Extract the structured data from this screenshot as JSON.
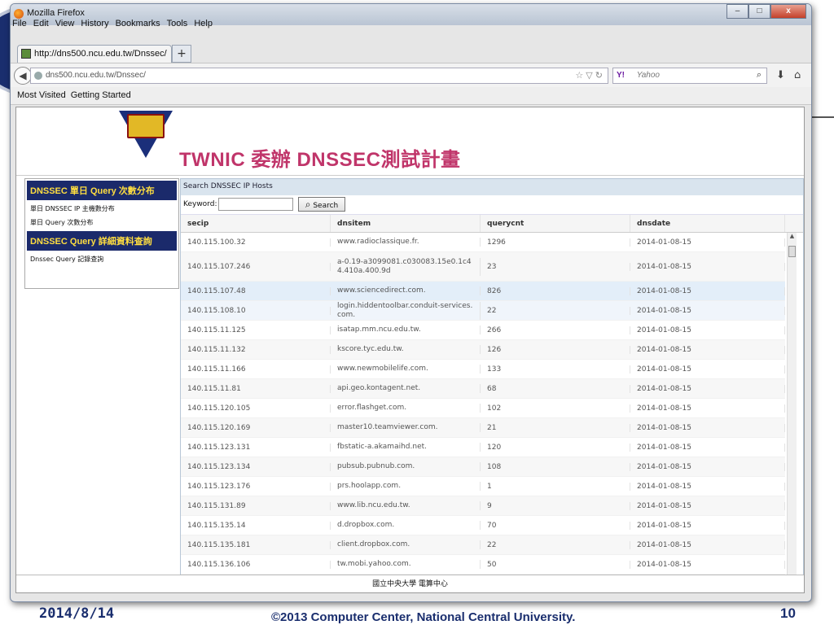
{
  "browser": {
    "window_title": "Mozilla Firefox",
    "menu": [
      "File",
      "Edit",
      "View",
      "History",
      "Bookmarks",
      "Tools",
      "Help"
    ],
    "tab_label": "http://dns500.ncu.edu.tw/Dnssec/",
    "new_tab": "+",
    "url": "dns500.ncu.edu.tw/Dnssec/",
    "search_engine": "Yahoo",
    "bookmarks": [
      "Most Visited",
      "Getting Started"
    ]
  },
  "site": {
    "title": "TWNIC 委辦 DNSSEC測試計畫",
    "sidebar": {
      "section1": "DNSSEC 單日 Query 次數分布",
      "section1_items": [
        "單日 DNSSEC IP 主機數分布",
        "單日 Query 次數分布"
      ],
      "section2": "DNSSEC Query 詳細資料查詢",
      "section2_items": [
        "Dnssec Query 記錄查詢"
      ]
    },
    "panel_title": "Search DNSSEC IP Hosts",
    "keyword_label": "Keyword:",
    "search_button": "Search",
    "columns": [
      "secip",
      "dnsitem",
      "querycnt",
      "dnsdate"
    ],
    "rows": [
      [
        "140.115.100.32",
        "www.radioclassique.fr.",
        "1296",
        "2014-01-08-15"
      ],
      [
        "140.115.107.246",
        "a-0.19-a3099081.c030083.15e0.1c44.410a.400.9d",
        "23",
        "2014-01-08-15"
      ],
      [
        "140.115.107.48",
        "www.sciencedirect.com.",
        "826",
        "2014-01-08-15"
      ],
      [
        "140.115.108.10",
        "login.hiddentoolbar.conduit-services.com.",
        "22",
        "2014-01-08-15"
      ],
      [
        "140.115.11.125",
        "isatap.mm.ncu.edu.tw.",
        "266",
        "2014-01-08-15"
      ],
      [
        "140.115.11.132",
        "kscore.tyc.edu.tw.",
        "126",
        "2014-01-08-15"
      ],
      [
        "140.115.11.166",
        "www.newmobilelife.com.",
        "133",
        "2014-01-08-15"
      ],
      [
        "140.115.11.81",
        "api.geo.kontagent.net.",
        "68",
        "2014-01-08-15"
      ],
      [
        "140.115.120.105",
        "error.flashget.com.",
        "102",
        "2014-01-08-15"
      ],
      [
        "140.115.120.169",
        "master10.teamviewer.com.",
        "21",
        "2014-01-08-15"
      ],
      [
        "140.115.123.131",
        "fbstatic-a.akamaihd.net.",
        "120",
        "2014-01-08-15"
      ],
      [
        "140.115.123.134",
        "pubsub.pubnub.com.",
        "108",
        "2014-01-08-15"
      ],
      [
        "140.115.123.176",
        "prs.hoolapp.com.",
        "1",
        "2014-01-08-15"
      ],
      [
        "140.115.131.89",
        "www.lib.ncu.edu.tw.",
        "9",
        "2014-01-08-15"
      ],
      [
        "140.115.135.14",
        "d.dropbox.com.",
        "70",
        "2014-01-08-15"
      ],
      [
        "140.115.135.181",
        "client.dropbox.com.",
        "22",
        "2014-01-08-15"
      ],
      [
        "140.115.136.106",
        "tw.mobi.yahoo.com.",
        "50",
        "2014-01-08-15"
      ]
    ],
    "footer": "國立中央大學 電算中心"
  },
  "slide": {
    "date": "2014/8/14",
    "copyright": "©2013 Computer Center, National Central University.",
    "page_number": "10"
  }
}
